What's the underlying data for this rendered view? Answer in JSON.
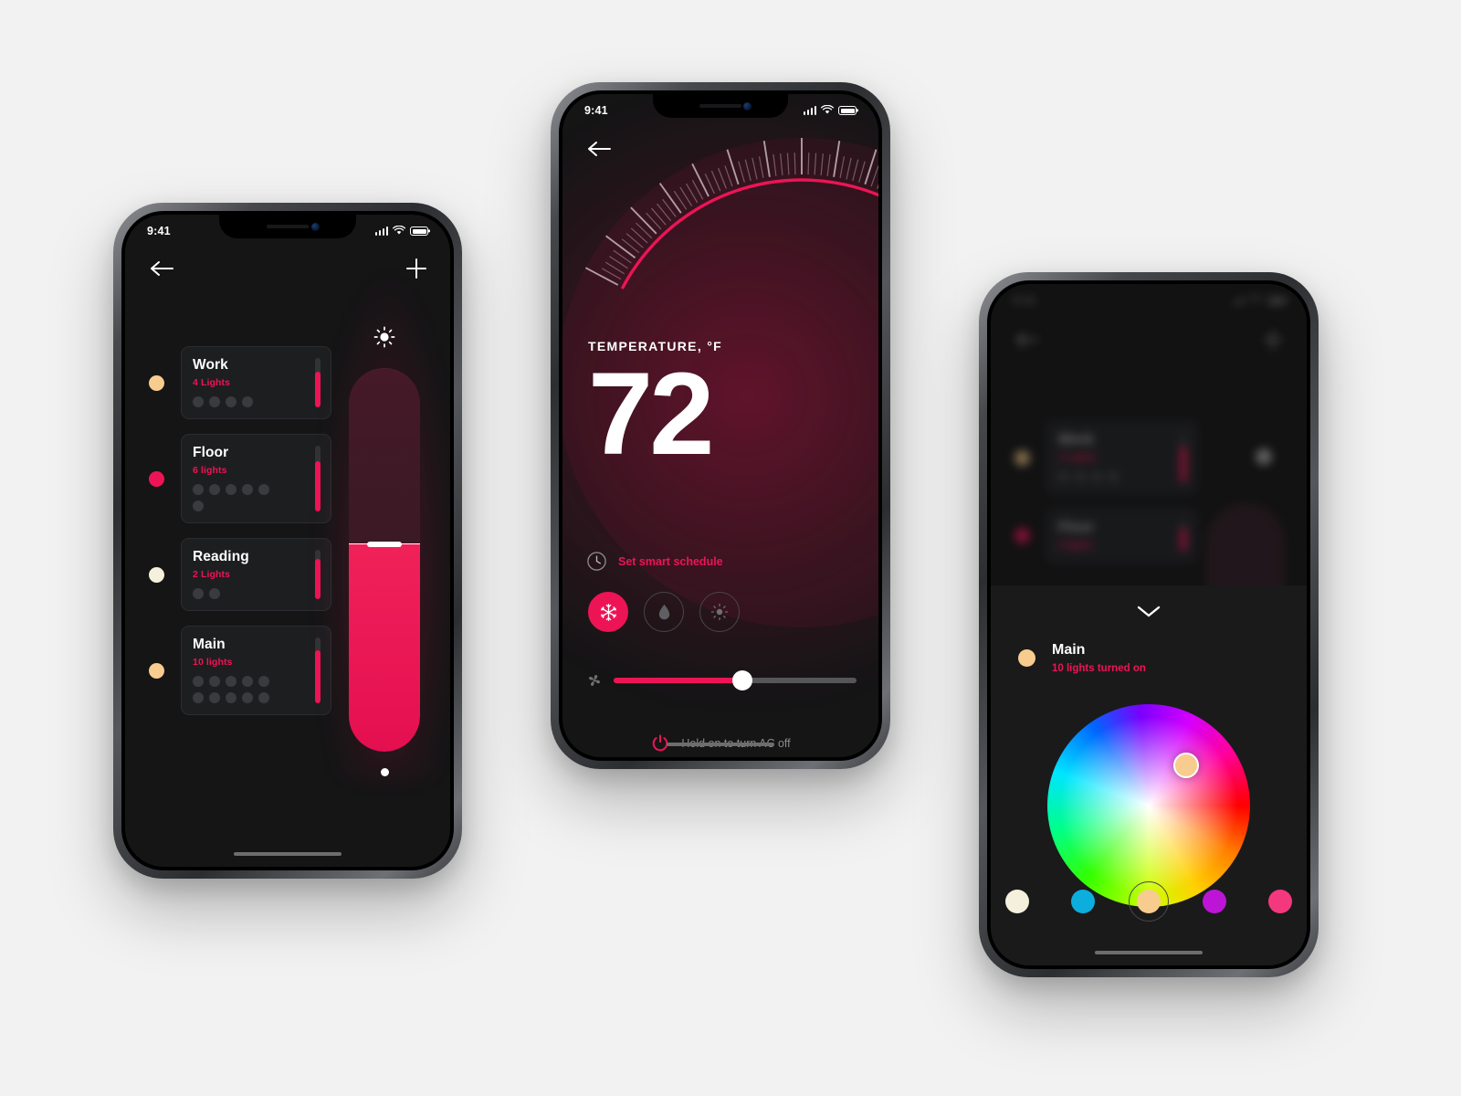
{
  "theme": {
    "accent": "#ED1455",
    "screen_bg": "#151516",
    "card_bg": "#1d1e20",
    "sheet_bg": "#1a1a1b"
  },
  "status_bar": {
    "time": "9:41",
    "signal_icon": "cellular-bars-icon",
    "wifi_icon": "wifi-icon",
    "battery_icon": "battery-icon"
  },
  "lights_screen": {
    "back_icon": "back-arrow-icon",
    "add_icon": "plus-icon",
    "brightness_icon": "sun-icon",
    "brightness_percent": 54,
    "rooms": [
      {
        "name": "Work",
        "subtitle": "4 Lights",
        "bulbs": 4,
        "dot_color": "#F8CC8E",
        "level": 72
      },
      {
        "name": "Floor",
        "subtitle": "6 lights",
        "bulbs": 6,
        "dot_color": "#ED1455",
        "level": 76
      },
      {
        "name": "Reading",
        "subtitle": "2 Lights",
        "bulbs": 2,
        "dot_color": "#F5F0DC",
        "level": 82
      },
      {
        "name": "Main",
        "subtitle": "10 lights",
        "bulbs": 10,
        "dot_color": "#F8CC8E",
        "level": 80
      }
    ]
  },
  "thermostat_screen": {
    "back_icon": "back-arrow-icon",
    "label": "TEMPERATURE, °F",
    "value": "72",
    "schedule_icon": "clock-icon",
    "schedule_label": "Set smart schedule",
    "modes": [
      {
        "id": "cool",
        "icon": "snowflake-icon",
        "active": true
      },
      {
        "id": "humidity",
        "icon": "water-drop-icon",
        "active": false
      },
      {
        "id": "heat",
        "icon": "sun-icon",
        "active": false
      }
    ],
    "fan_icon": "fan-icon",
    "fan_level": 53,
    "power_icon": "power-icon",
    "power_label": "Hold on to turn AC off",
    "gauge": {
      "min_angle": -62,
      "max_angle": 62,
      "ticks": 70,
      "arc_color": "#ED1455"
    }
  },
  "color_screen": {
    "collapse_icon": "chevron-down-icon",
    "room_dot_color": "#F8CC8E",
    "room_name": "Main",
    "room_status": "10 lights turned on",
    "wheel_selection": {
      "color": "#F8CC8E",
      "x_pct": 70,
      "y_pct": 30
    },
    "swatches": [
      {
        "name": "warm-white",
        "color": "#F5F0DC",
        "selected": false
      },
      {
        "name": "cyan",
        "color": "#0BAEDD",
        "selected": false
      },
      {
        "name": "peach",
        "color": "#F8CC8E",
        "selected": true
      },
      {
        "name": "purple",
        "color": "#BD15D5",
        "selected": false
      },
      {
        "name": "pink",
        "color": "#F4387E",
        "selected": false
      }
    ]
  }
}
